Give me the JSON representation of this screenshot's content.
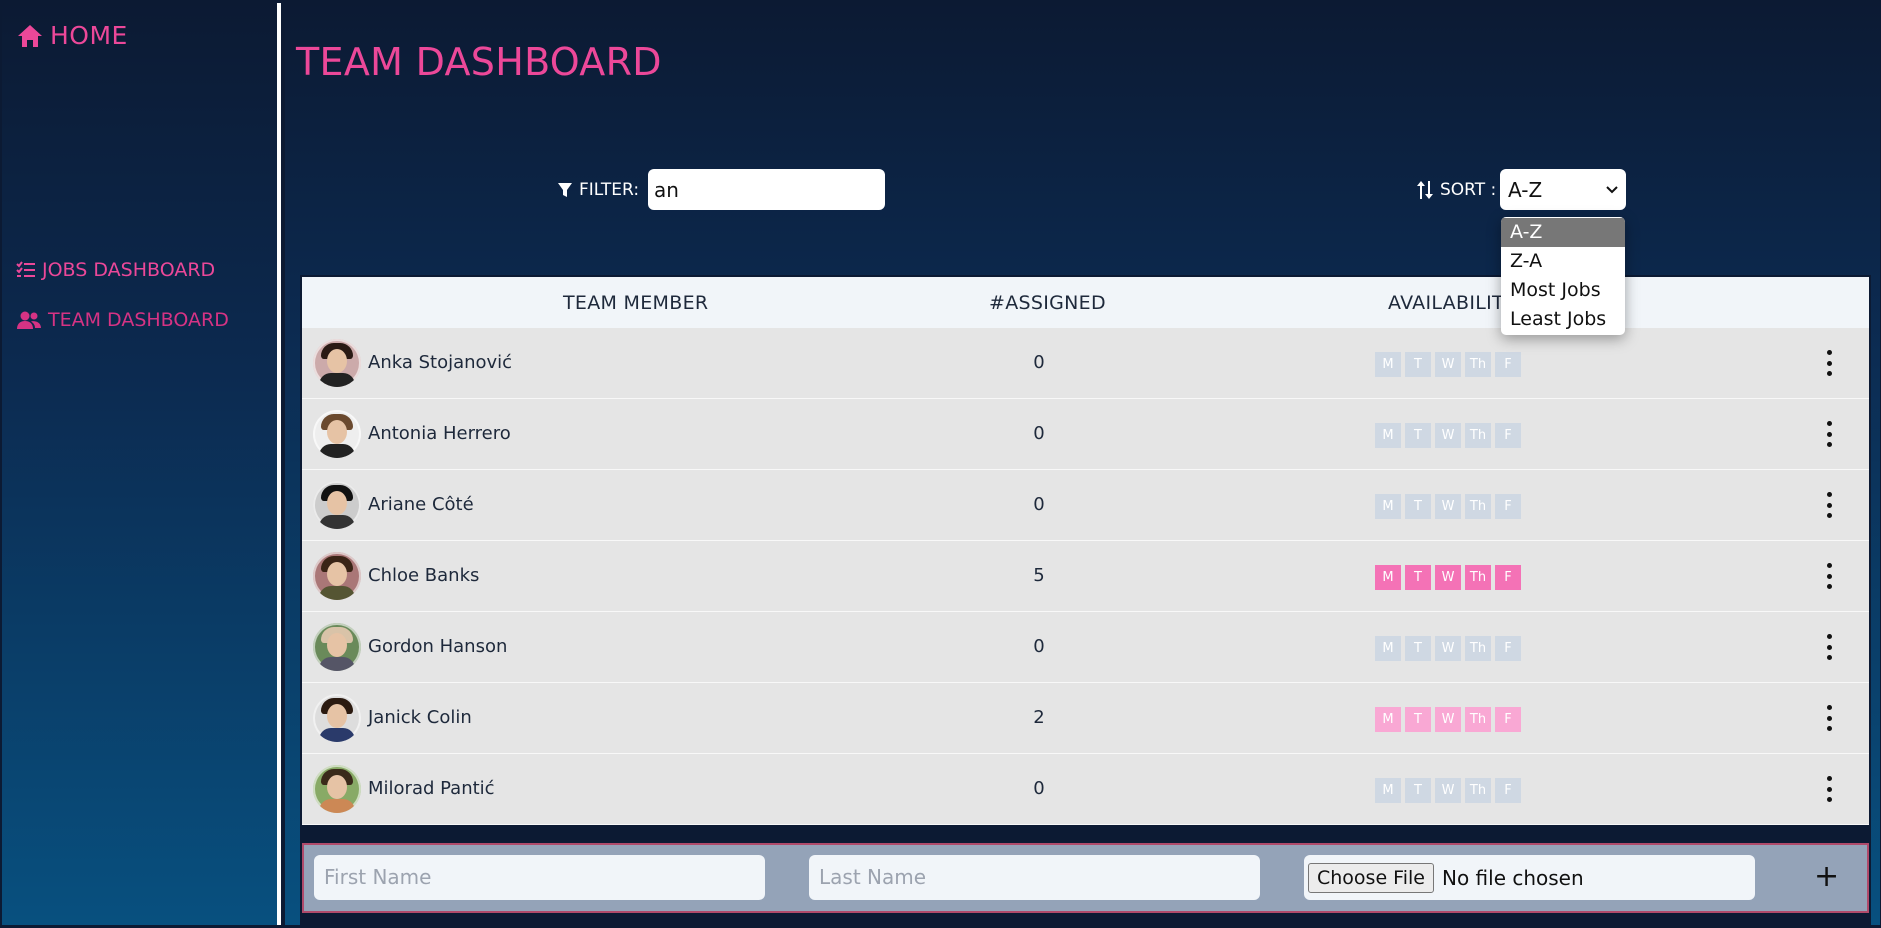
{
  "sidebar": {
    "home_label": "HOME",
    "items": [
      {
        "label": "JOBS DASHBOARD",
        "icon": "tasks-list-icon"
      },
      {
        "label": "TEAM DASHBOARD",
        "icon": "users-icon"
      }
    ]
  },
  "page": {
    "title": "TEAM DASHBOARD"
  },
  "filter": {
    "label": "FILTER:",
    "value": "an"
  },
  "sort": {
    "label": "SORT :",
    "selected": "A-Z",
    "options": [
      "A-Z",
      "Z-A",
      "Most Jobs",
      "Least Jobs"
    ]
  },
  "table": {
    "headers": {
      "member": "TEAM MEMBER",
      "assigned": "#ASSIGNED",
      "availability": "AVAILABILITY"
    },
    "day_labels": [
      "M",
      "T",
      "W",
      "Th",
      "F"
    ],
    "rows": [
      {
        "name": "Anka Stojanović",
        "assigned": "0",
        "available": [
          false,
          false,
          false,
          false,
          false
        ]
      },
      {
        "name": "Antonia Herrero",
        "assigned": "0",
        "available": [
          false,
          false,
          false,
          false,
          false
        ]
      },
      {
        "name": "Ariane Côté",
        "assigned": "0",
        "available": [
          false,
          false,
          false,
          false,
          false
        ]
      },
      {
        "name": "Chloe Banks",
        "assigned": "5",
        "available": [
          true,
          true,
          true,
          true,
          true
        ]
      },
      {
        "name": "Gordon Hanson",
        "assigned": "0",
        "available": [
          false,
          false,
          false,
          false,
          false
        ]
      },
      {
        "name": "Janick Colin",
        "assigned": "2",
        "available": [
          true,
          true,
          true,
          true,
          true
        ]
      },
      {
        "name": "Milorad Pantić",
        "assigned": "0",
        "available": [
          false,
          false,
          false,
          false,
          false
        ]
      }
    ]
  },
  "add_member": {
    "first_name_placeholder": "First Name",
    "last_name_placeholder": "Last Name",
    "file_button": "Choose File",
    "file_status": "No file chosen",
    "add_symbol": "+"
  },
  "colors": {
    "accent": "#ec4899",
    "day_on": "#f9a8d4",
    "day_off": "#cfd8e3"
  }
}
